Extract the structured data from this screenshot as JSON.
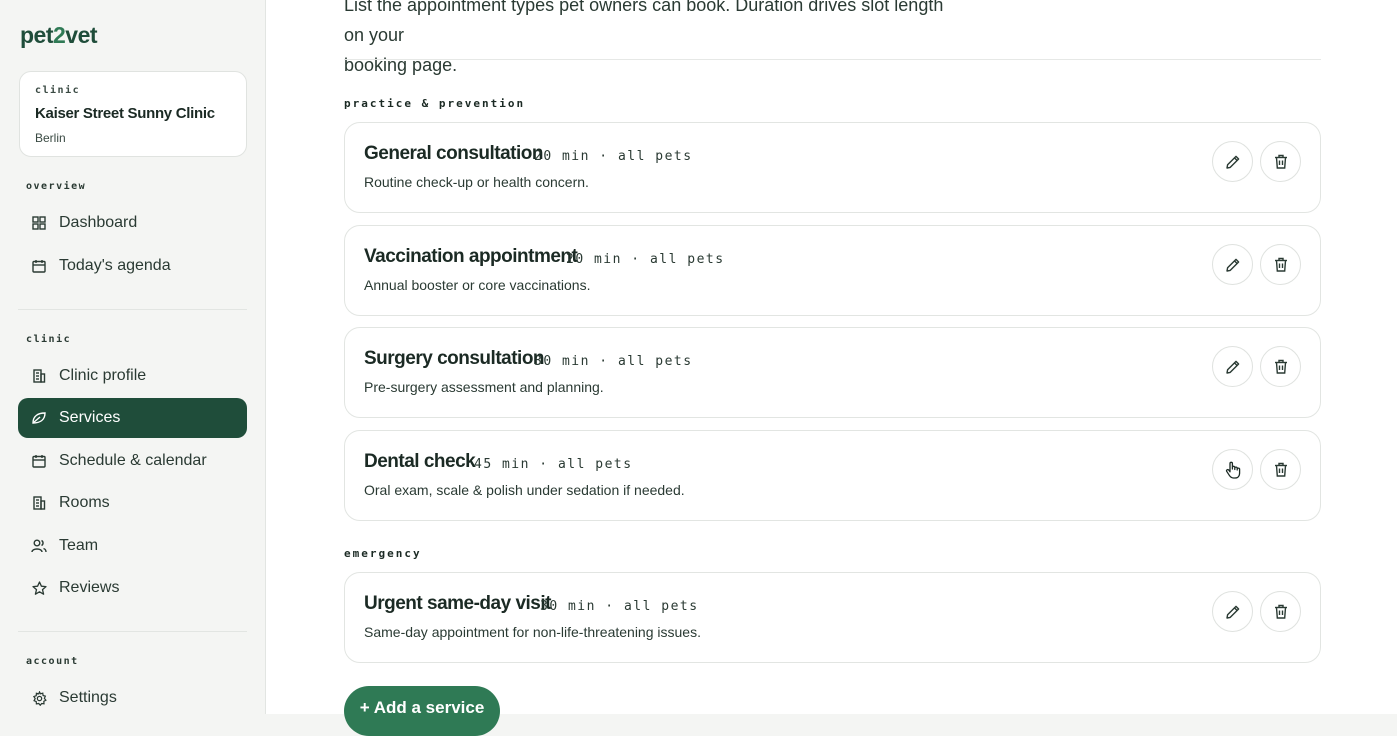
{
  "brand": {
    "logo_left": "pet",
    "logo_two": "2",
    "logo_right": "vet"
  },
  "clinic_card": {
    "tag": "clinic",
    "name": "Kaiser Street Sunny Clinic",
    "city": "Berlin"
  },
  "sidebar": {
    "overview_label": "overview",
    "clinic_label": "clinic",
    "account_label": "account",
    "items": [
      {
        "label": "Dashboard",
        "icon": "dashboard-icon"
      },
      {
        "label": "Today's agenda",
        "icon": "calendar-icon"
      },
      {
        "label": "Clinic profile",
        "icon": "building-icon"
      },
      {
        "label": "Services",
        "icon": "leaf-icon",
        "active": true
      },
      {
        "label": "Schedule & calendar",
        "icon": "calendar-icon"
      },
      {
        "label": "Rooms",
        "icon": "building-icon"
      },
      {
        "label": "Team",
        "icon": "users-icon"
      },
      {
        "label": "Reviews",
        "icon": "star-icon"
      },
      {
        "label": "Settings",
        "icon": "gear-icon"
      }
    ]
  },
  "main": {
    "intro_line1": "List the appointment types pet owners can book. Duration drives slot length on your",
    "intro_line2": "booking page.",
    "groups": [
      {
        "label": "practice & prevention",
        "services": [
          {
            "name": "General consultation",
            "meta": "20 min · all pets",
            "desc": "Routine check-up or health concern."
          },
          {
            "name": "Vaccination appointment",
            "meta": "20 min · all pets",
            "desc": "Annual booster or core vaccinations."
          },
          {
            "name": "Surgery consultation",
            "meta": "30 min · all pets",
            "desc": "Pre-surgery assessment and planning."
          },
          {
            "name": "Dental check",
            "meta": "45 min · all pets",
            "desc": "Oral exam, scale & polish under sedation if needed."
          }
        ]
      },
      {
        "label": "emergency",
        "services": [
          {
            "name": "Urgent same-day visit",
            "meta": "30 min · all pets",
            "desc": "Same-day appointment for non-life-threatening issues."
          }
        ]
      }
    ],
    "add_button": "+ Add a service"
  },
  "colors": {
    "accent": "#1f4d3a",
    "accent_light": "#2f7a55",
    "danger": "#c0392b"
  }
}
